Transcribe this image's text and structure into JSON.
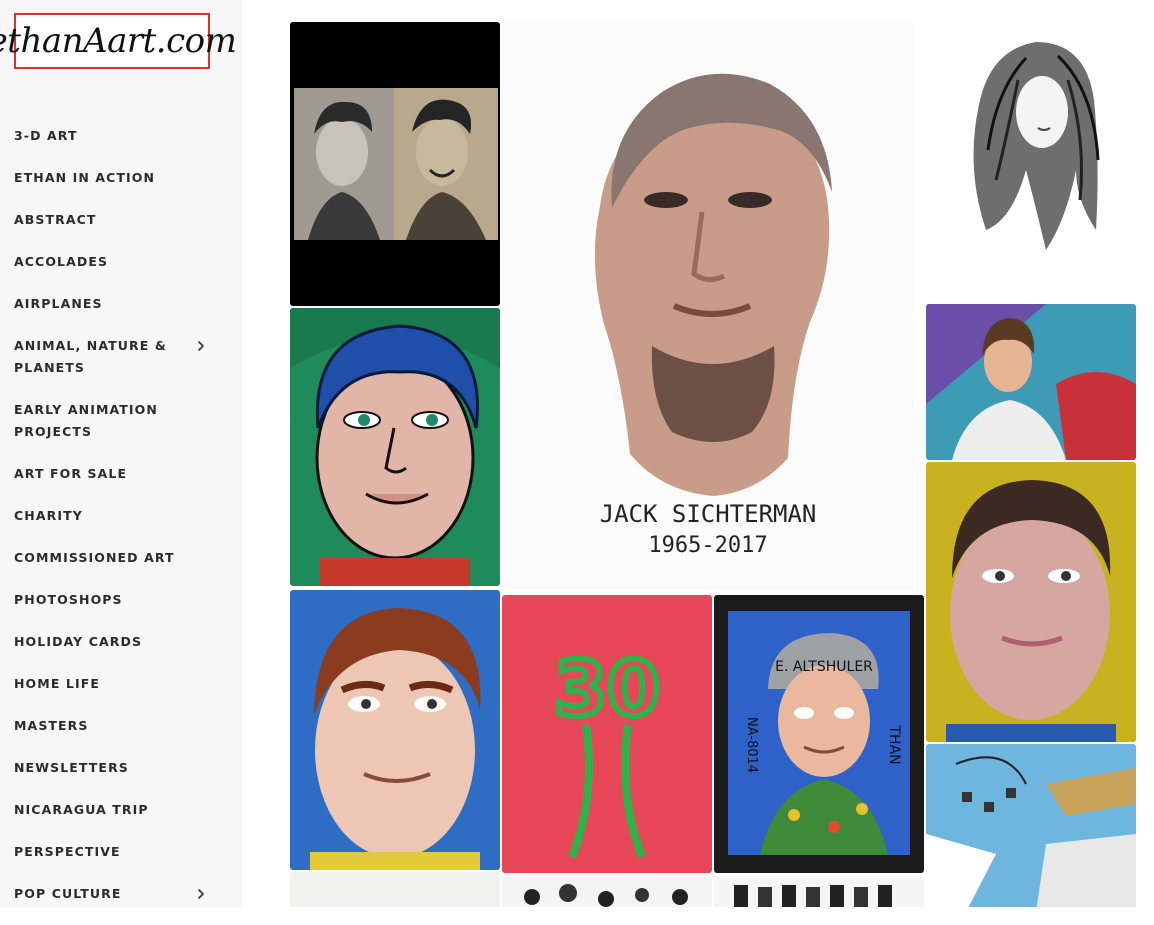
{
  "site": {
    "logo_text": "ethanAart.com"
  },
  "nav": {
    "items": [
      {
        "label": "3-D ART",
        "has_submenu": false
      },
      {
        "label": "ETHAN IN ACTION",
        "has_submenu": false
      },
      {
        "label": "ABSTRACT",
        "has_submenu": false
      },
      {
        "label": "ACCOLADES",
        "has_submenu": false
      },
      {
        "label": "AIRPLANES",
        "has_submenu": false
      },
      {
        "label": "ANIMAL, NATURE & PLANETS",
        "has_submenu": true
      },
      {
        "label": "EARLY ANIMATION PROJECTS",
        "has_submenu": false
      },
      {
        "label": "ART FOR SALE",
        "has_submenu": false
      },
      {
        "label": "CHARITY",
        "has_submenu": false
      },
      {
        "label": "COMMISSIONED ART",
        "has_submenu": false
      },
      {
        "label": "PHOTOSHOPS",
        "has_submenu": false
      },
      {
        "label": "HOLIDAY CARDS",
        "has_submenu": false
      },
      {
        "label": "HOME LIFE",
        "has_submenu": false
      },
      {
        "label": "MASTERS",
        "has_submenu": false
      },
      {
        "label": "NEWSLETTERS",
        "has_submenu": false
      },
      {
        "label": "NICARAGUA TRIP",
        "has_submenu": false
      },
      {
        "label": "PERSPECTIVE",
        "has_submenu": false
      },
      {
        "label": "POP CULTURE",
        "has_submenu": true
      }
    ]
  },
  "gallery": {
    "memorial": {
      "name_text": "JACK SICHTERMAN",
      "years_text": "1965-2017"
    },
    "framed": {
      "cap_text": "E. ALTSHULER",
      "side_right": "THAN",
      "side_left": "NA-8014"
    },
    "number_painting": {
      "number_text": "30"
    },
    "colors": {
      "accent_logo_border": "#d9312b",
      "sidebar_bg": "#f7f7f7"
    }
  }
}
